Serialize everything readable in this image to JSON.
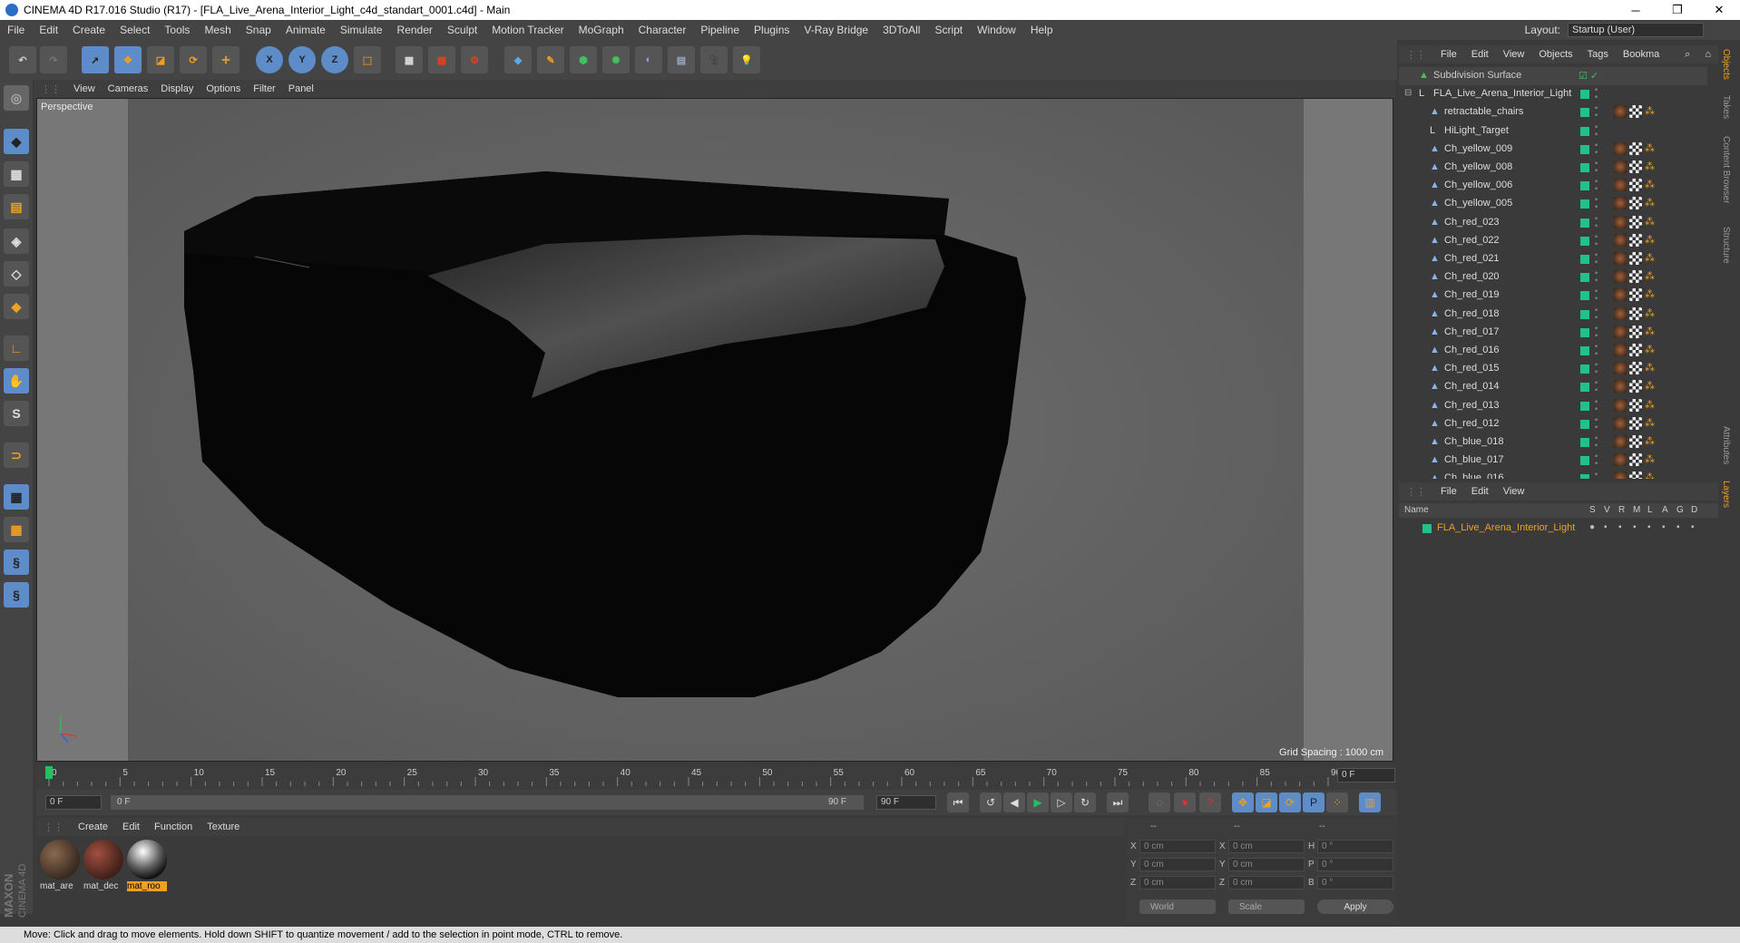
{
  "window": {
    "title": "CINEMA 4D R17.016 Studio (R17) - [FLA_Live_Arena_Interior_Light_c4d_standart_0001.c4d] - Main",
    "controls": [
      "─",
      "❐",
      "✕"
    ]
  },
  "menubar": [
    "File",
    "Edit",
    "Create",
    "Select",
    "Tools",
    "Mesh",
    "Snap",
    "Animate",
    "Simulate",
    "Render",
    "Sculpt",
    "Motion Tracker",
    "MoGraph",
    "Character",
    "Pipeline",
    "Plugins",
    "V-Ray Bridge",
    "3DToAll",
    "Script",
    "Window",
    "Help"
  ],
  "layout": {
    "label": "Layout:",
    "value": "Startup (User)"
  },
  "toolbar": {
    "x": "X",
    "y": "Y",
    "z": "Z"
  },
  "viewport": {
    "menu": [
      "View",
      "Cameras",
      "Display",
      "Options",
      "Filter",
      "Panel"
    ],
    "label": "Perspective",
    "grid_spacing": "Grid Spacing : 1000 cm"
  },
  "timeline": {
    "ticks": [
      "0",
      "5",
      "10",
      "15",
      "20",
      "25",
      "30",
      "35",
      "40",
      "45",
      "50",
      "55",
      "60",
      "65",
      "70",
      "75",
      "80",
      "85",
      "90"
    ],
    "current_frame": "0 F",
    "start_field": "0 F",
    "range_start": "0 F",
    "range_end": "90 F",
    "end_field": "90 F"
  },
  "materials": {
    "menu": [
      "Create",
      "Edit",
      "Function",
      "Texture"
    ],
    "items": [
      {
        "name": "mat_are",
        "selected": false
      },
      {
        "name": "mat_dec",
        "selected": false
      },
      {
        "name": "mat_roo",
        "selected": true
      }
    ]
  },
  "coords": {
    "headers": [
      "--",
      "--",
      "--"
    ],
    "rows": [
      {
        "a": "X",
        "av": "0 cm",
        "b": "X",
        "bv": "0 cm",
        "c": "H",
        "cv": "0 °"
      },
      {
        "a": "Y",
        "av": "0 cm",
        "b": "Y",
        "bv": "0 cm",
        "c": "P",
        "cv": "0 °"
      },
      {
        "a": "Z",
        "av": "0 cm",
        "b": "Z",
        "bv": "0 cm",
        "c": "B",
        "cv": "0 °"
      }
    ],
    "mode1": "World",
    "mode2": "Scale",
    "apply": "Apply"
  },
  "status": "Move: Click and drag to move elements. Hold down SHIFT to quantize movement / add to the selection in point mode, CTRL to remove.",
  "object_manager": {
    "menu": [
      "File",
      "Edit",
      "View",
      "Objects",
      "Tags",
      "Bookma"
    ],
    "objects": [
      {
        "name": "Subdivision Surface",
        "level": 0,
        "kind": "subdiv"
      },
      {
        "name": "FLA_Live_Arena_Interior_Light",
        "level": 0,
        "kind": "null"
      },
      {
        "name": "retractable_chairs",
        "level": 1,
        "kind": "mesh"
      },
      {
        "name": "HiLight_Target",
        "level": 1,
        "kind": "null"
      },
      {
        "name": "Ch_yellow_009",
        "level": 1,
        "kind": "mesh"
      },
      {
        "name": "Ch_yellow_008",
        "level": 1,
        "kind": "mesh"
      },
      {
        "name": "Ch_yellow_006",
        "level": 1,
        "kind": "mesh"
      },
      {
        "name": "Ch_yellow_005",
        "level": 1,
        "kind": "mesh"
      },
      {
        "name": "Ch_red_023",
        "level": 1,
        "kind": "mesh"
      },
      {
        "name": "Ch_red_022",
        "level": 1,
        "kind": "mesh"
      },
      {
        "name": "Ch_red_021",
        "level": 1,
        "kind": "mesh"
      },
      {
        "name": "Ch_red_020",
        "level": 1,
        "kind": "mesh"
      },
      {
        "name": "Ch_red_019",
        "level": 1,
        "kind": "mesh"
      },
      {
        "name": "Ch_red_018",
        "level": 1,
        "kind": "mesh"
      },
      {
        "name": "Ch_red_017",
        "level": 1,
        "kind": "mesh"
      },
      {
        "name": "Ch_red_016",
        "level": 1,
        "kind": "mesh"
      },
      {
        "name": "Ch_red_015",
        "level": 1,
        "kind": "mesh"
      },
      {
        "name": "Ch_red_014",
        "level": 1,
        "kind": "mesh"
      },
      {
        "name": "Ch_red_013",
        "level": 1,
        "kind": "mesh"
      },
      {
        "name": "Ch_red_012",
        "level": 1,
        "kind": "mesh"
      },
      {
        "name": "Ch_blue_018",
        "level": 1,
        "kind": "mesh"
      },
      {
        "name": "Ch_blue_017",
        "level": 1,
        "kind": "mesh"
      },
      {
        "name": "Ch_blue_016",
        "level": 1,
        "kind": "mesh"
      }
    ]
  },
  "right_tabs": [
    "Objects",
    "Takes",
    "Content Browser",
    "Structure",
    "Attributes",
    "Layers"
  ],
  "layer_manager": {
    "menu": [
      "File",
      "Edit",
      "View"
    ],
    "header": {
      "name": "Name",
      "cols": [
        "S",
        "V",
        "R",
        "M",
        "L",
        "A",
        "G",
        "D"
      ]
    },
    "layers": [
      {
        "name": "FLA_Live_Arena_Interior_Light"
      }
    ]
  },
  "colors": {
    "accent_orange": "#f0a020",
    "layer_name": "#f0a020",
    "object_green": "#22c08a",
    "tool_blue": "#5d8cc9"
  }
}
